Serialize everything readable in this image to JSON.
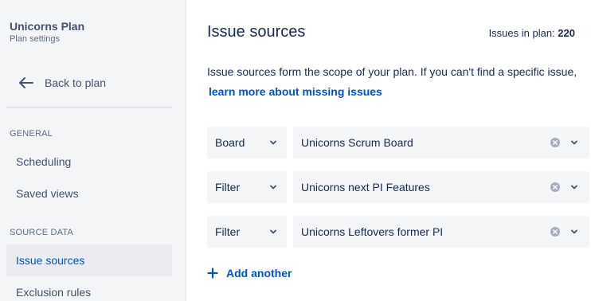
{
  "sidebar": {
    "plan_name": "Unicorns Plan",
    "plan_subtitle": "Plan settings",
    "back_label": "Back to plan",
    "sections": [
      {
        "title": "GENERAL",
        "items": [
          {
            "label": "Scheduling"
          },
          {
            "label": "Saved views"
          }
        ]
      },
      {
        "title": "SOURCE DATA",
        "items": [
          {
            "label": "Issue sources",
            "active": true
          },
          {
            "label": "Exclusion rules"
          }
        ]
      }
    ]
  },
  "main": {
    "title": "Issue sources",
    "issues_in_plan_label": "Issues in plan:",
    "issues_in_plan_count": "220",
    "description": "Issue sources form the scope of your plan. If you can't find a specific issue,",
    "learn_more_link": "learn more about missing issues",
    "learn_more_suffix": ".",
    "sources": [
      {
        "type": "Board",
        "value": "Unicorns Scrum Board"
      },
      {
        "type": "Filter",
        "value": "Unicorns next PI Features"
      },
      {
        "type": "Filter",
        "value": "Unicorns Leftovers former PI"
      }
    ],
    "add_another_label": "Add another"
  },
  "colors": {
    "sidebar_bg": "#f4f5f7",
    "active_item_bg": "#ebecf0",
    "link": "#0052cc",
    "text": "#172b4d",
    "muted_text": "#5e6c84"
  },
  "icons": {
    "back": "arrow-left-icon",
    "chevron": "chevron-down-icon",
    "clear": "clear-x-circle-icon",
    "add": "plus-icon"
  }
}
